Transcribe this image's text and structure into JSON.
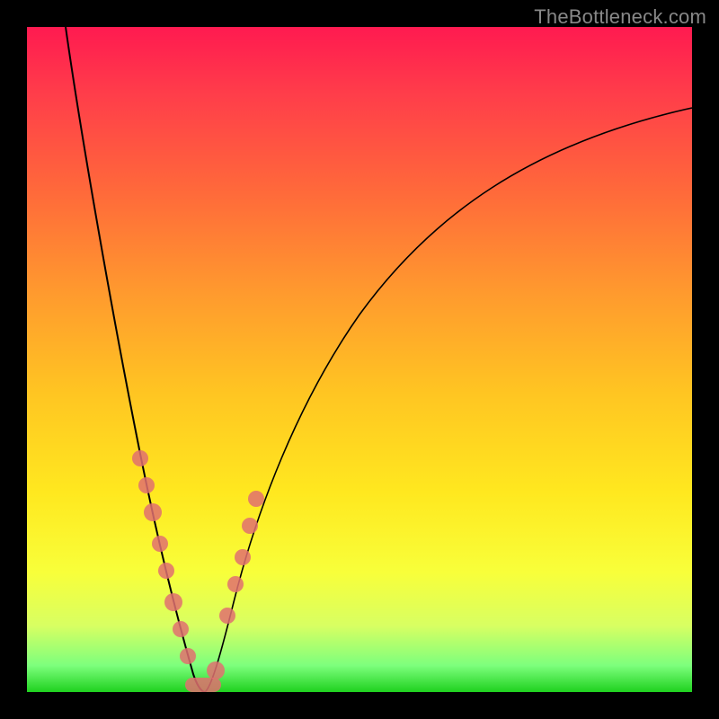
{
  "watermark": "TheBottleneck.com",
  "colors": {
    "background": "#000000",
    "gradient_top": "#ff1a50",
    "gradient_mid": "#ffe81f",
    "gradient_bottom": "#1fd11f",
    "curve": "#000000",
    "beads": "#e07070",
    "watermark": "#888888"
  },
  "chart_data": {
    "type": "line",
    "title": "",
    "xlabel": "",
    "ylabel": "",
    "xlim": [
      0,
      100
    ],
    "ylim": [
      0,
      100
    ],
    "grid": false,
    "legend": false,
    "trough_x": 26,
    "note": "V-shaped bottleneck curve. y-values read against the color gradient (red=high, green=low); y here is distance-from-bottom in percent of plot height.",
    "series": [
      {
        "name": "left edge",
        "x": [
          6,
          8,
          10,
          12,
          14,
          16,
          18,
          20,
          22,
          24,
          26
        ],
        "y": [
          100,
          90,
          78,
          65,
          52,
          40,
          30,
          20,
          12,
          5,
          0
        ]
      },
      {
        "name": "right edge",
        "x": [
          26,
          28,
          30,
          32,
          35,
          40,
          45,
          50,
          55,
          60,
          70,
          80,
          90,
          100
        ],
        "y": [
          0,
          5,
          12,
          20,
          30,
          42,
          52,
          60,
          66,
          71,
          78,
          83,
          86,
          88
        ]
      }
    ],
    "beads": {
      "note": "approximate positions of the pink beads along each curve edge, bottom-of-plot y percentages",
      "left": [
        {
          "x": 17,
          "y": 35
        },
        {
          "x": 18,
          "y": 30
        },
        {
          "x": 19,
          "y": 25
        },
        {
          "x": 20,
          "y": 20
        },
        {
          "x": 21,
          "y": 15
        },
        {
          "x": 22,
          "y": 11
        },
        {
          "x": 23,
          "y": 8
        },
        {
          "x": 24,
          "y": 5
        }
      ],
      "right": [
        {
          "x": 30,
          "y": 12
        },
        {
          "x": 31,
          "y": 17
        },
        {
          "x": 32,
          "y": 22
        },
        {
          "x": 33,
          "y": 27
        },
        {
          "x": 34,
          "y": 31
        }
      ],
      "bottom_cluster": [
        {
          "x": 25,
          "y": 1
        },
        {
          "x": 26,
          "y": 0
        },
        {
          "x": 27,
          "y": 1
        },
        {
          "x": 28,
          "y": 2
        }
      ]
    }
  }
}
